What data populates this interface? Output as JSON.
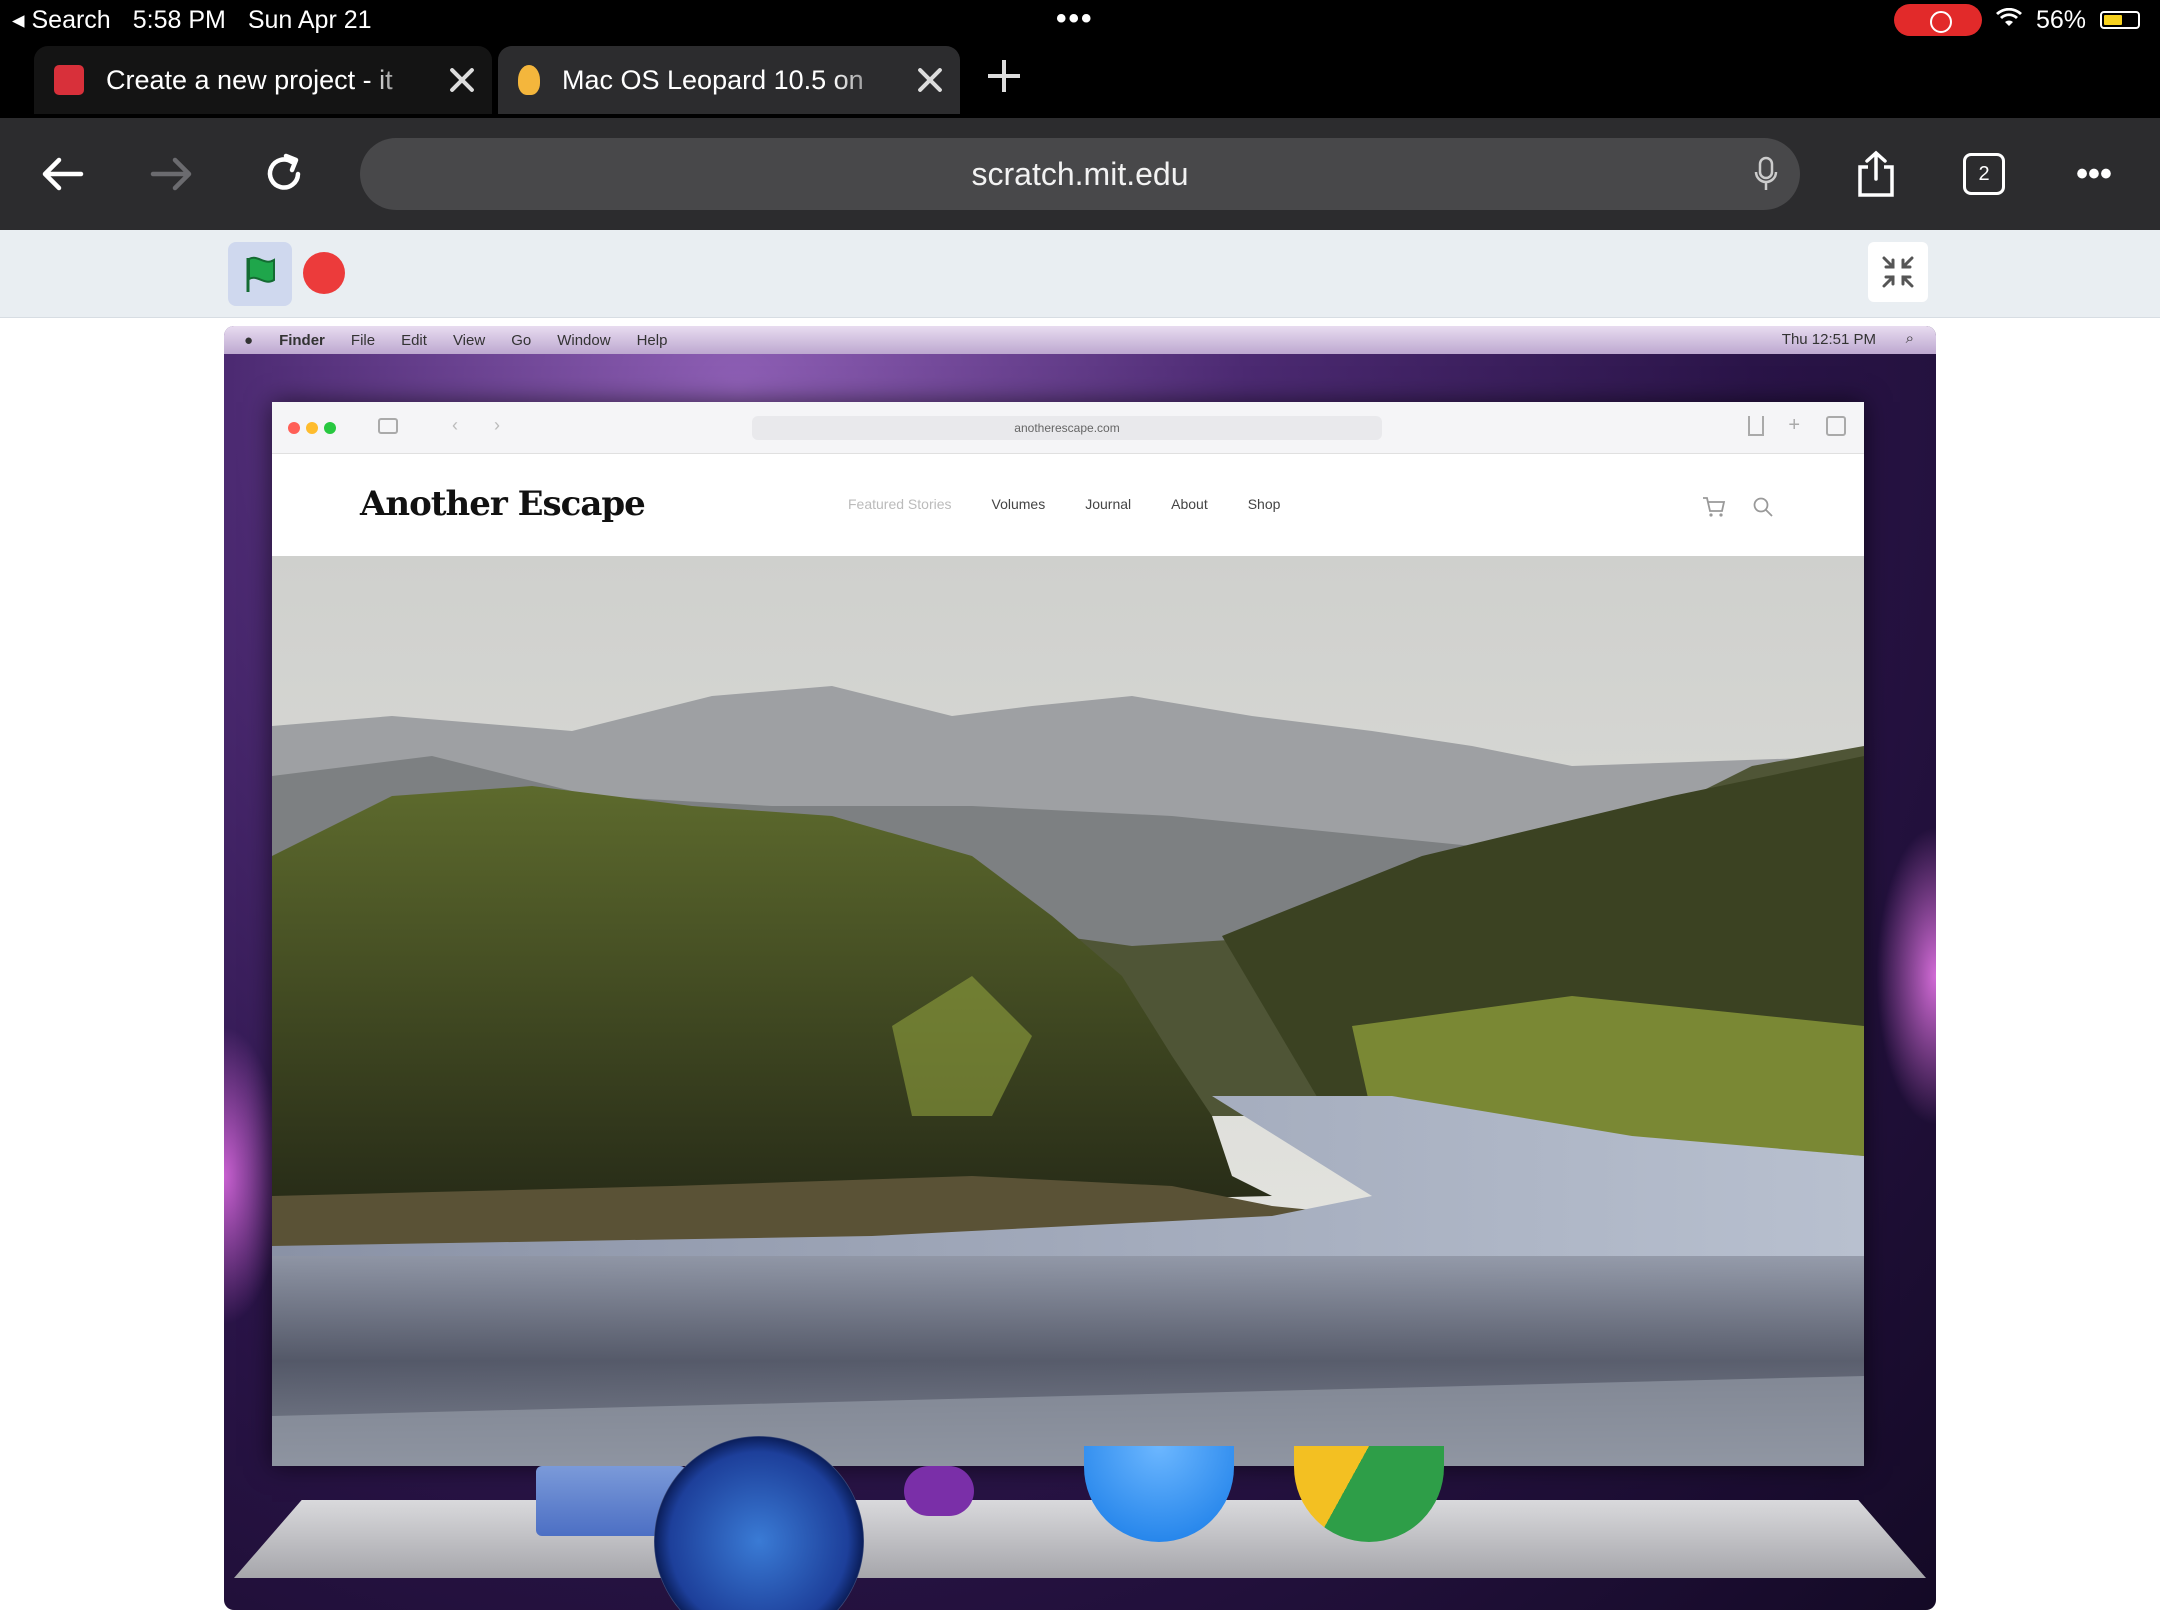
{
  "status_bar": {
    "back_label": "◂ Search",
    "time": "5:58 PM",
    "date": "Sun Apr 21",
    "battery": "56%",
    "battery_level": 0.56
  },
  "tabs": [
    {
      "title": "Create a new project - it",
      "favicon_color": "#d8303a",
      "active": false
    },
    {
      "title": "Mac OS Leopard 10.5 on",
      "favicon_color": "#f4b63c",
      "active": true
    }
  ],
  "toolbar": {
    "url": "scratch.mit.edu",
    "tab_count": "2"
  },
  "stage": {
    "mac_menu": [
      "Finder",
      "File",
      "Edit",
      "View",
      "Go",
      "Window",
      "Help"
    ],
    "mac_clock": "Thu 12:51 PM",
    "safari_url": "anotherescape.com",
    "site": {
      "logo": "Another Escape",
      "nav": [
        "Featured Stories",
        "Volumes",
        "Journal",
        "About",
        "Shop"
      ]
    },
    "dock_icons": [
      "finder-icon",
      "safari-icon",
      "app-icon",
      "app-store-icon",
      "chrome-icon"
    ]
  },
  "colors": {
    "accent_red": "#ec3b3b",
    "flag_green": "#1fa64b",
    "safari_dark": "#2c2c2e"
  }
}
